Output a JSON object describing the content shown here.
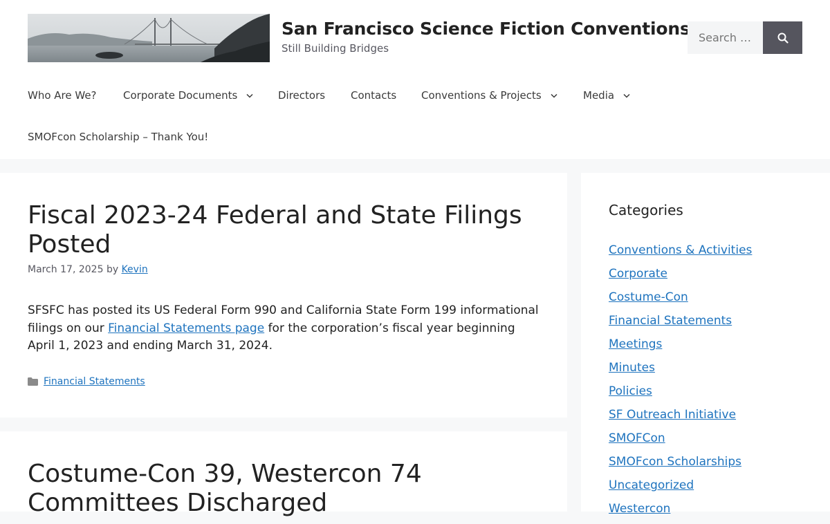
{
  "site": {
    "title": "San Francisco Science Fiction Conventions, Inc.",
    "tagline": "Still Building Bridges"
  },
  "search": {
    "placeholder": "Search …",
    "button_icon": "search-icon"
  },
  "nav": {
    "items": [
      {
        "label": "Who Are We?",
        "has_dropdown": false
      },
      {
        "label": "Corporate Documents",
        "has_dropdown": true
      },
      {
        "label": "Directors",
        "has_dropdown": false
      },
      {
        "label": "Contacts",
        "has_dropdown": false
      },
      {
        "label": "Conventions & Projects",
        "has_dropdown": true
      },
      {
        "label": "Media",
        "has_dropdown": true
      },
      {
        "label": "SMOFcon Scholarship – Thank You!",
        "has_dropdown": false
      }
    ]
  },
  "posts": [
    {
      "title": "Fiscal 2023-24 Federal and State Filings Posted",
      "date": "March 17, 2025",
      "by": "by",
      "author": "Kevin",
      "body_before_link": "SFSFC has posted its US Federal Form 990 and California State Form 199 informational filings on our ",
      "body_link": "Financial Statements page",
      "body_after_link": " for the corporation’s fiscal year beginning April 1, 2023 and ending March 31, 2024.",
      "category": "Financial Statements"
    },
    {
      "title": "Costume-Con 39, Westercon 74 Committees Discharged"
    }
  ],
  "sidebar": {
    "widget_title": "Categories",
    "categories": [
      "Conventions & Activities",
      "Corporate",
      "Costume-Con",
      "Financial Statements",
      "Meetings",
      "Minutes",
      "Policies",
      "SF Outreach Initiative",
      "SMOFCon",
      "SMOFcon Scholarships",
      "Uncategorized",
      "Westercon"
    ]
  },
  "colors": {
    "link": "#1e73be",
    "page_background": "#f7f8f9",
    "search_button": "#55555e",
    "text": "#222222"
  }
}
